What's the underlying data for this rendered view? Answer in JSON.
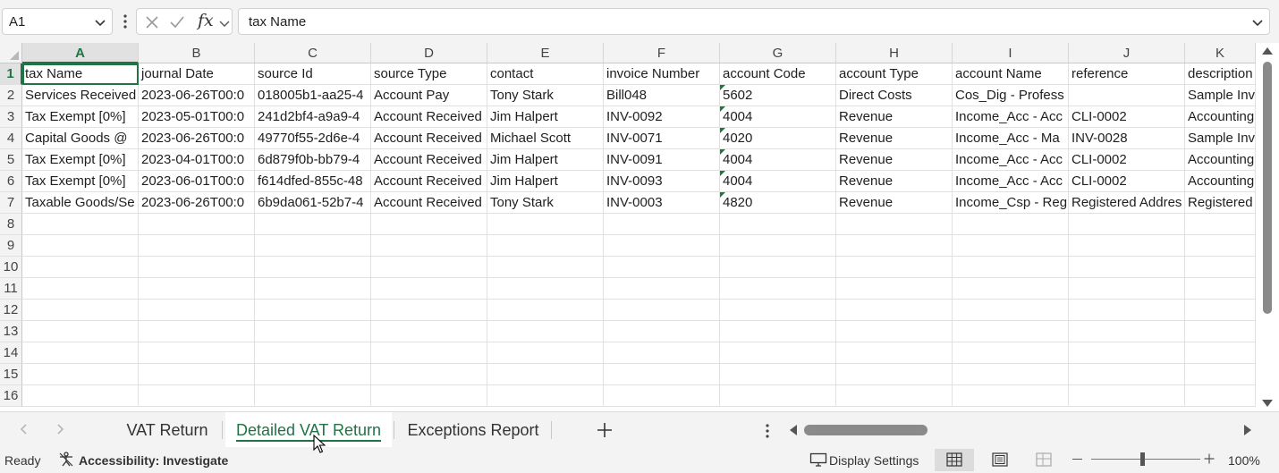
{
  "formula_bar": {
    "name_box": "A1",
    "formula": "tax Name",
    "fx_label": "fx"
  },
  "columns": [
    "A",
    "B",
    "C",
    "D",
    "E",
    "F",
    "G",
    "H",
    "I",
    "J",
    "K"
  ],
  "row_numbers": [
    "1",
    "2",
    "3",
    "4",
    "5",
    "6",
    "7",
    "8",
    "9",
    "10",
    "11",
    "12",
    "13",
    "14",
    "15",
    "16"
  ],
  "rows": [
    [
      "tax Name",
      "journal Date",
      "source Id",
      "source Type",
      "contact",
      "invoice Number",
      "account Code",
      "account Type",
      "account Name",
      "reference",
      "description"
    ],
    [
      "Services Received",
      "2023-06-26T00:0",
      "018005b1-aa25-4",
      "Account Pay",
      "Tony Stark",
      "Bill048",
      "5602",
      "Direct Costs",
      "Cos_Dig - Profess",
      "",
      "Sample Inv"
    ],
    [
      "Tax Exempt [0%]",
      "2023-05-01T00:0",
      "241d2bf4-a9a9-4",
      "Account Received",
      "Jim Halpert",
      "INV-0092",
      "4004",
      "Revenue",
      "Income_Acc - Acc",
      "CLI-0002",
      "Accounting"
    ],
    [
      "Capital Goods @",
      "2023-06-26T00:0",
      "49770f55-2d6e-4",
      "Account Received",
      "Michael Scott",
      "INV-0071",
      "4020",
      "Revenue",
      "Income_Acc - Ma",
      "INV-0028",
      "Sample Inv"
    ],
    [
      "Tax Exempt [0%]",
      "2023-04-01T00:0",
      "6d879f0b-bb79-4",
      "Account Received",
      "Jim Halpert",
      "INV-0091",
      "4004",
      "Revenue",
      "Income_Acc - Acc",
      "CLI-0002",
      "Accounting"
    ],
    [
      "Tax Exempt [0%]",
      "2023-06-01T00:0",
      "f614dfed-855c-48",
      "Account Received",
      "Jim Halpert",
      "INV-0093",
      "4004",
      "Revenue",
      "Income_Acc - Acc",
      "CLI-0002",
      "Accounting"
    ],
    [
      "Taxable Goods/Se",
      "2023-06-26T00:0",
      "6b9da061-52b7-4",
      "Account Received",
      "Tony Stark",
      "INV-0003",
      "4820",
      "Revenue",
      "Income_Csp - Reg",
      "Registered Addres",
      "Registered"
    ]
  ],
  "number_as_text_column": 6,
  "sheet_tabs": [
    {
      "label": "VAT Return",
      "active": false
    },
    {
      "label": "Detailed VAT Return",
      "active": true
    },
    {
      "label": "Exceptions Report",
      "active": false
    }
  ],
  "status_bar": {
    "ready": "Ready",
    "accessibility": "Accessibility: Investigate",
    "display_settings": "Display Settings",
    "zoom": "100%"
  },
  "colors": {
    "accent": "#217346",
    "toolbar_bg": "#f3f3f3",
    "grid_line": "#e1e1e1"
  }
}
